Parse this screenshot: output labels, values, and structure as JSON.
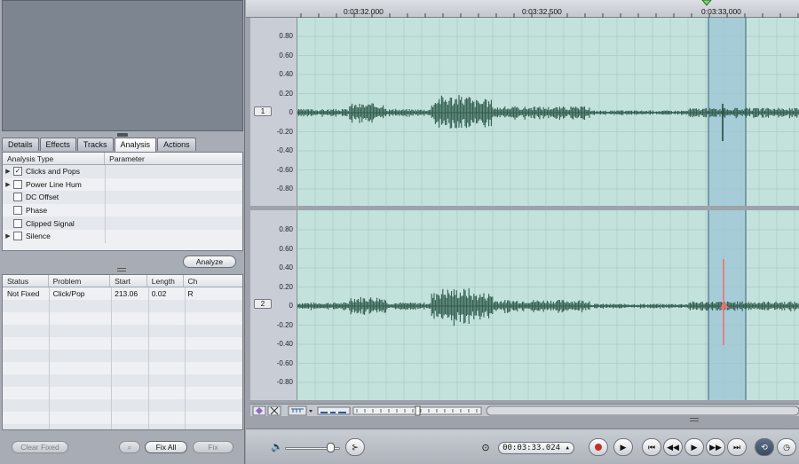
{
  "tabs": [
    "Details",
    "Effects",
    "Tracks",
    "Analysis",
    "Actions"
  ],
  "active_tab": "Analysis",
  "analysis_table": {
    "headers": [
      "Analysis Type",
      "Parameter"
    ],
    "rows": [
      {
        "label": "Clicks and Pops",
        "checked": true,
        "expandable": true
      },
      {
        "label": "Power Line Hum",
        "checked": false,
        "expandable": true
      },
      {
        "label": "DC Offset",
        "checked": false,
        "expandable": false
      },
      {
        "label": "Phase",
        "checked": false,
        "expandable": false
      },
      {
        "label": "Clipped Signal",
        "checked": false,
        "expandable": false
      },
      {
        "label": "Silence",
        "checked": false,
        "expandable": true
      }
    ]
  },
  "analyze_button": "Analyze",
  "results_table": {
    "headers": [
      "Status",
      "Problem",
      "Start",
      "Length",
      "Ch"
    ],
    "rows": [
      {
        "status": "Not Fixed",
        "problem": "Click/Pop",
        "start": "213.06",
        "length": "0.02",
        "ch": "R"
      }
    ]
  },
  "buttons": {
    "clear_fixed": "Clear Fixed",
    "fix_all": "Fix All",
    "fix": "Fix"
  },
  "ruler": {
    "labels": [
      "0:03:32.000",
      "0:03:32.500",
      "0:03:33.000"
    ]
  },
  "tracks": [
    {
      "number": "1",
      "y_labels": [
        "0.80",
        "0.60",
        "0.40",
        "0.20",
        "0",
        "-0.20",
        "-0.40",
        "-0.60",
        "-0.80"
      ]
    },
    {
      "number": "2",
      "y_labels": [
        "0.80",
        "0.60",
        "0.40",
        "0.20",
        "0",
        "-0.20",
        "-0.40",
        "-0.60",
        "-0.80"
      ]
    }
  ],
  "transport": {
    "timecode": "00:03:33.024"
  },
  "colors": {
    "waveform": "#2f5b4c",
    "track_bg": "#c3e2dc",
    "selection": "#9cc4d6",
    "highlight": "#ee7070",
    "record": "#c4302b"
  }
}
